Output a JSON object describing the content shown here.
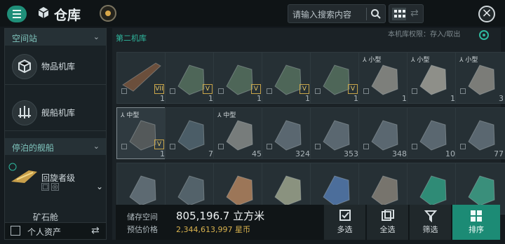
{
  "header": {
    "title": "仓库",
    "search_placeholder": "请输入搜索内容"
  },
  "sidebar": {
    "space_station": "空间站",
    "item_hangar": "物品机库",
    "ship_hangar": "舰船机库",
    "docked_ships": "停泊的舰船",
    "ship_name": "回旋者级",
    "ore_bay": "矿石舱",
    "personal_assets": "个人资产"
  },
  "main": {
    "hangar_name": "第二机库",
    "permission": "本机库权限：存入/取出"
  },
  "items": [
    {
      "count": "1",
      "level": "VII",
      "size": ""
    },
    {
      "count": "1",
      "level": "V",
      "size": ""
    },
    {
      "count": "1",
      "level": "V",
      "size": ""
    },
    {
      "count": "1",
      "level": "V",
      "size": ""
    },
    {
      "count": "1",
      "level": "V",
      "size": ""
    },
    {
      "count": "1",
      "level": "",
      "size": "小型"
    },
    {
      "count": "1",
      "level": "",
      "size": "小型"
    },
    {
      "count": "3",
      "level": "",
      "size": "小型"
    },
    {
      "count": "1",
      "level": "V",
      "size": "中型"
    },
    {
      "count": "7",
      "level": "",
      "size": ""
    },
    {
      "count": "45",
      "level": "",
      "size": "中型"
    },
    {
      "count": "324",
      "level": "",
      "size": ""
    },
    {
      "count": "353",
      "level": "",
      "size": ""
    },
    {
      "count": "348",
      "level": "",
      "size": ""
    },
    {
      "count": "10",
      "level": "",
      "size": ""
    },
    {
      "count": "77",
      "level": "",
      "size": ""
    },
    {
      "count": "",
      "level": "",
      "size": ""
    },
    {
      "count": "",
      "level": "",
      "size": ""
    },
    {
      "count": "",
      "level": "",
      "size": ""
    },
    {
      "count": "",
      "level": "",
      "size": ""
    },
    {
      "count": "",
      "level": "",
      "size": ""
    },
    {
      "count": "",
      "level": "",
      "size": ""
    },
    {
      "count": "",
      "level": "",
      "size": ""
    },
    {
      "count": "",
      "level": "",
      "size": ""
    }
  ],
  "footer": {
    "storage_label": "储存空间",
    "storage_value": "805,196.7 立方米",
    "value_label": "预估价格",
    "value_amount": "2,344,613,997 星币",
    "multi_select": "多选",
    "select_all": "全选",
    "filter": "筛选",
    "sort": "排序"
  },
  "colors": {
    "accent": "#1c8b75",
    "isk": "#d8b24e",
    "label": "#2fb89e"
  }
}
